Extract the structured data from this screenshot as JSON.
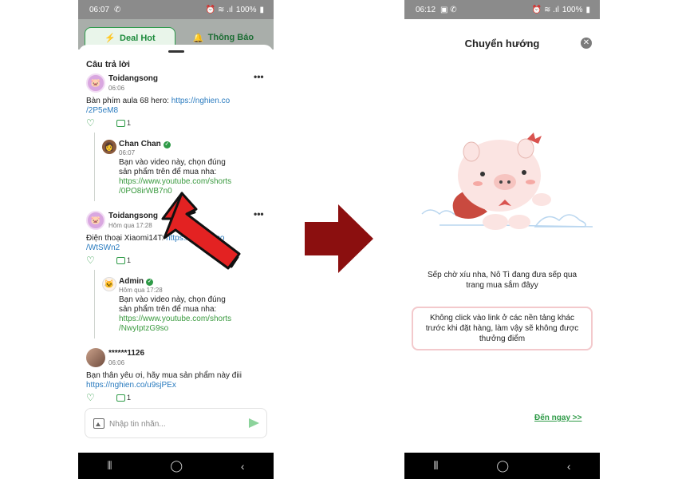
{
  "left_screen": {
    "status_bar": {
      "time": "06:07",
      "battery": "100%"
    },
    "tabs": [
      {
        "label": "Deal Hot",
        "icon": "lightning-icon",
        "active": true
      },
      {
        "label": "Thông Báo",
        "icon": "bell-icon",
        "active": false
      }
    ],
    "section_title": "Câu trả lời",
    "comments": [
      {
        "user": "Toidangsong",
        "time": "06:06",
        "text": "Bàn phím aula 68 hero: ",
        "link_line1": "https://nghien.co",
        "link_line2": "/2P5eM8",
        "reply_count": "1",
        "reply": {
          "user": "Chan Chan",
          "time": "06:07",
          "line1": "Bạn vào video này, chọn đúng",
          "line2": "sản phẩm trên để mua nha:",
          "link1": "https://www.youtube.com/shorts",
          "link2": "/0PO8irWB7n0"
        }
      },
      {
        "user": "Toidangsong",
        "time": "Hôm qua 17:28",
        "text": "Điện thoại Xiaomi14T: ",
        "link_line1": "https://nghien.co",
        "link_line2": "/WtSWn2",
        "reply_count": "1",
        "reply": {
          "user": "Admin",
          "time": "Hôm qua 17:28",
          "line1": "Bạn vào video này, chọn đúng",
          "line2": "sản phẩm trên để mua nha:",
          "link1": "https://www.youtube.com/shorts",
          "link2": "/NwyIptzG9so"
        }
      },
      {
        "user": "******1126",
        "time": "06:06",
        "text": "Bạn thân yêu ơi, hãy mua sản phẩm này điii",
        "link_line1": "https://nghien.co/u9sjPEx",
        "reply_count": "1"
      }
    ],
    "message_placeholder": "Nhập tin nhắn..."
  },
  "right_screen": {
    "status_bar": {
      "time": "06:12",
      "battery": "100%"
    },
    "title": "Chuyển hướng",
    "waiting_line1": "Sếp chờ xíu nha, Nô Tì đang đưa sếp qua",
    "waiting_line2": "trang mua sắm đâyy",
    "warning_line1": "Không click vào link ở các nền tảng khác",
    "warning_line2": "trước khi đặt hàng, làm vậy sẽ không được",
    "warning_line3": "thưởng điểm",
    "go_now": "Đến ngay >>"
  },
  "colors": {
    "accent_green": "#2e9a47",
    "link_blue": "#2a7bbf",
    "arrow_red": "#8b0f0f",
    "warning_border": "#f3c9cc"
  }
}
